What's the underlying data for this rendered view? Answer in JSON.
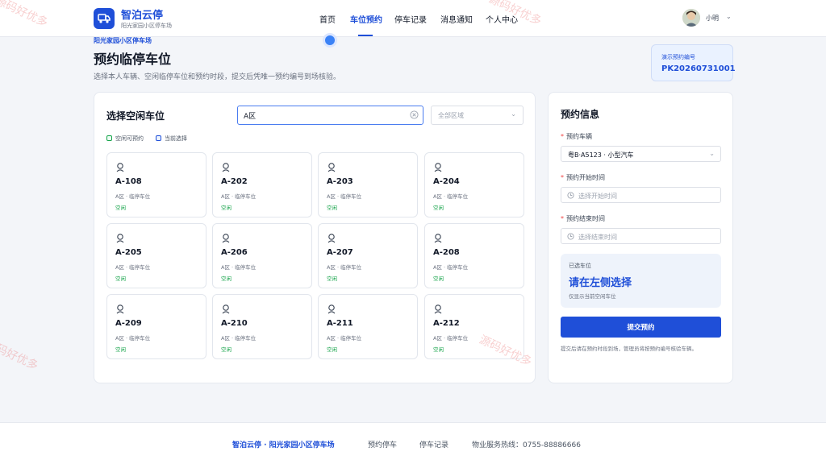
{
  "header": {
    "brand_title": "智泊云停",
    "brand_subtitle": "阳光家园小区停车场",
    "nav": [
      {
        "label": "首页",
        "active": false
      },
      {
        "label": "车位预约",
        "active": true
      },
      {
        "label": "停车记录",
        "active": false
      },
      {
        "label": "消息通知",
        "active": false
      },
      {
        "label": "个人中心",
        "active": false
      }
    ],
    "user_name": "小明"
  },
  "page": {
    "breadcrumb": "阳光家园小区停车场",
    "title": "预约临停车位",
    "description": "选择本人车辆、空闲临停车位和预约时段，提交后凭唯一预约编号到场核验。",
    "demo_label": "演示预约编号",
    "demo_value": "PK20260731001"
  },
  "spots_panel": {
    "title": "选择空闲车位",
    "search_value": "A区",
    "zone_placeholder": "全部区域",
    "legend_free": "空闲可预约",
    "legend_selected": "当前选择",
    "spots": [
      {
        "code": "A-108",
        "meta": "A区 · 临停车位",
        "status": "空闲"
      },
      {
        "code": "A-202",
        "meta": "A区 · 临停车位",
        "status": "空闲"
      },
      {
        "code": "A-203",
        "meta": "A区 · 临停车位",
        "status": "空闲"
      },
      {
        "code": "A-204",
        "meta": "A区 · 临停车位",
        "status": "空闲"
      },
      {
        "code": "A-205",
        "meta": "A区 · 临停车位",
        "status": "空闲"
      },
      {
        "code": "A-206",
        "meta": "A区 · 临停车位",
        "status": "空闲"
      },
      {
        "code": "A-207",
        "meta": "A区 · 临停车位",
        "status": "空闲"
      },
      {
        "code": "A-208",
        "meta": "A区 · 临停车位",
        "status": "空闲"
      },
      {
        "code": "A-209",
        "meta": "A区 · 临停车位",
        "status": "空闲"
      },
      {
        "code": "A-210",
        "meta": "A区 · 临停车位",
        "status": "空闲"
      },
      {
        "code": "A-211",
        "meta": "A区 · 临停车位",
        "status": "空闲"
      },
      {
        "code": "A-212",
        "meta": "A区 · 临停车位",
        "status": "空闲"
      }
    ]
  },
  "booking": {
    "title": "预约信息",
    "vehicle_label": "预约车辆",
    "vehicle_value": "粤B·A5123 · 小型汽车",
    "start_label": "预约开始时间",
    "start_placeholder": "选择开始时间",
    "end_label": "预约结束时间",
    "end_placeholder": "选择结束时间",
    "chosen_label": "已选车位",
    "chosen_value": "请在左侧选择",
    "chosen_hint": "仅显示当前空闲车位",
    "submit_label": "提交预约",
    "note": "提交后请在预约时段到场，管理员将按预约编号核验车辆。"
  },
  "footer": {
    "brand": "智泊云停 · 阳光家园小区停车场",
    "links": [
      "预约停车",
      "停车记录"
    ],
    "phone": "物业服务热线：0755-88886666"
  },
  "watermark": "源码好优多",
  "colors": {
    "accent": "#1f4fd8",
    "free": "#16a34a",
    "required": "#ef4444"
  }
}
